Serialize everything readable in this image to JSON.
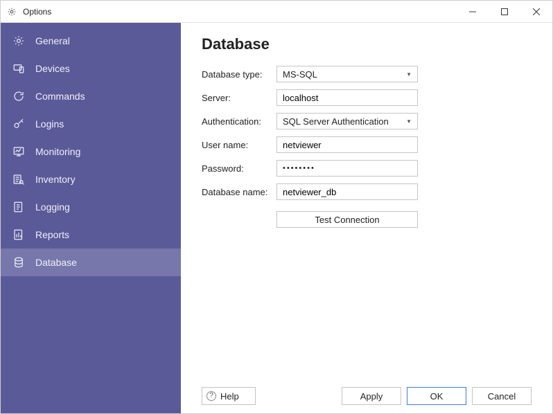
{
  "window": {
    "title": "Options"
  },
  "sidebar": {
    "items": [
      {
        "key": "general",
        "label": "General"
      },
      {
        "key": "devices",
        "label": "Devices"
      },
      {
        "key": "commands",
        "label": "Commands"
      },
      {
        "key": "logins",
        "label": "Logins"
      },
      {
        "key": "monitoring",
        "label": "Monitoring"
      },
      {
        "key": "inventory",
        "label": "Inventory"
      },
      {
        "key": "logging",
        "label": "Logging"
      },
      {
        "key": "reports",
        "label": "Reports"
      },
      {
        "key": "database",
        "label": "Database"
      }
    ],
    "selected": "database"
  },
  "main": {
    "title": "Database",
    "labels": {
      "database_type": "Database type:",
      "server": "Server:",
      "authentication": "Authentication:",
      "user_name": "User name:",
      "password": "Password:",
      "database_name": "Database name:"
    },
    "values": {
      "database_type": "MS-SQL",
      "server": "localhost",
      "authentication": "SQL Server Authentication",
      "user_name": "netviewer",
      "password_mask": "••••••••",
      "database_name": "netviewer_db"
    },
    "buttons": {
      "test_connection": "Test Connection"
    }
  },
  "footer": {
    "help": "Help",
    "apply": "Apply",
    "ok": "OK",
    "cancel": "Cancel"
  }
}
